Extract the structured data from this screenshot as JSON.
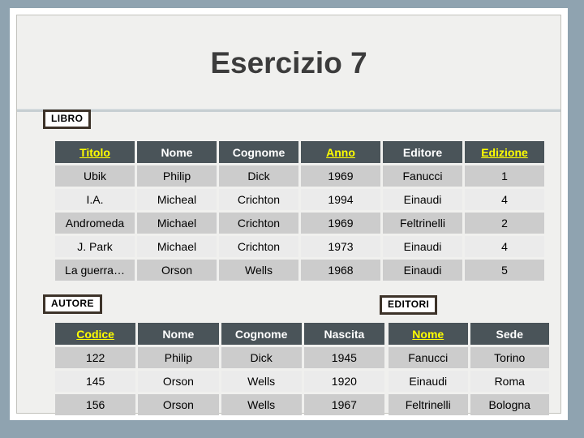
{
  "slide": {
    "title": "Esercizio 7"
  },
  "entities": {
    "libro": {
      "label": "LIBRO",
      "columns": [
        {
          "label": "Titolo",
          "key": true
        },
        {
          "label": "Nome",
          "key": false
        },
        {
          "label": "Cognome",
          "key": false
        },
        {
          "label": "Anno",
          "key": true
        },
        {
          "label": "Editore",
          "key": false
        },
        {
          "label": "Edizione",
          "key": true
        }
      ],
      "rows": [
        [
          "Ubik",
          "Philip",
          "Dick",
          "1969",
          "Fanucci",
          "1"
        ],
        [
          "I.A.",
          "Micheal",
          "Crichton",
          "1994",
          "Einaudi",
          "4"
        ],
        [
          "Andromeda",
          "Michael",
          "Crichton",
          "1969",
          "Feltrinelli",
          "2"
        ],
        [
          "J. Park",
          "Michael",
          "Crichton",
          "1973",
          "Einaudi",
          "4"
        ],
        [
          "La guerra…",
          "Orson",
          "Wells",
          "1968",
          "Einaudi",
          "5"
        ]
      ]
    },
    "autore": {
      "label": "AUTORE",
      "columns": [
        {
          "label": "Codice",
          "key": true
        },
        {
          "label": "Nome",
          "key": false
        },
        {
          "label": "Cognome",
          "key": false
        },
        {
          "label": "Nascita",
          "key": false
        }
      ],
      "rows": [
        [
          "122",
          "Philip",
          "Dick",
          "1945"
        ],
        [
          "145",
          "Orson",
          "Wells",
          "1920"
        ],
        [
          "156",
          "Orson",
          "Wells",
          "1967"
        ]
      ]
    },
    "editori": {
      "label": "EDITORI",
      "columns": [
        {
          "label": "Nome",
          "key": true
        },
        {
          "label": "Sede",
          "key": false
        }
      ],
      "rows": [
        [
          "Fanucci",
          "Torino"
        ],
        [
          "Einaudi",
          "Roma"
        ],
        [
          "Feltrinelli",
          "Bologna"
        ]
      ]
    }
  },
  "colors": {
    "page_background": "#8fa3b0",
    "slide_background": "#f0f0ee",
    "header_cell": "#4a5459",
    "header_key_text": "#ffff00",
    "header_text": "#ffffff",
    "row_odd": "#cccccc",
    "row_even": "#ebebeb",
    "title_text": "#3c3c3c",
    "label_border": "#3d3329"
  }
}
